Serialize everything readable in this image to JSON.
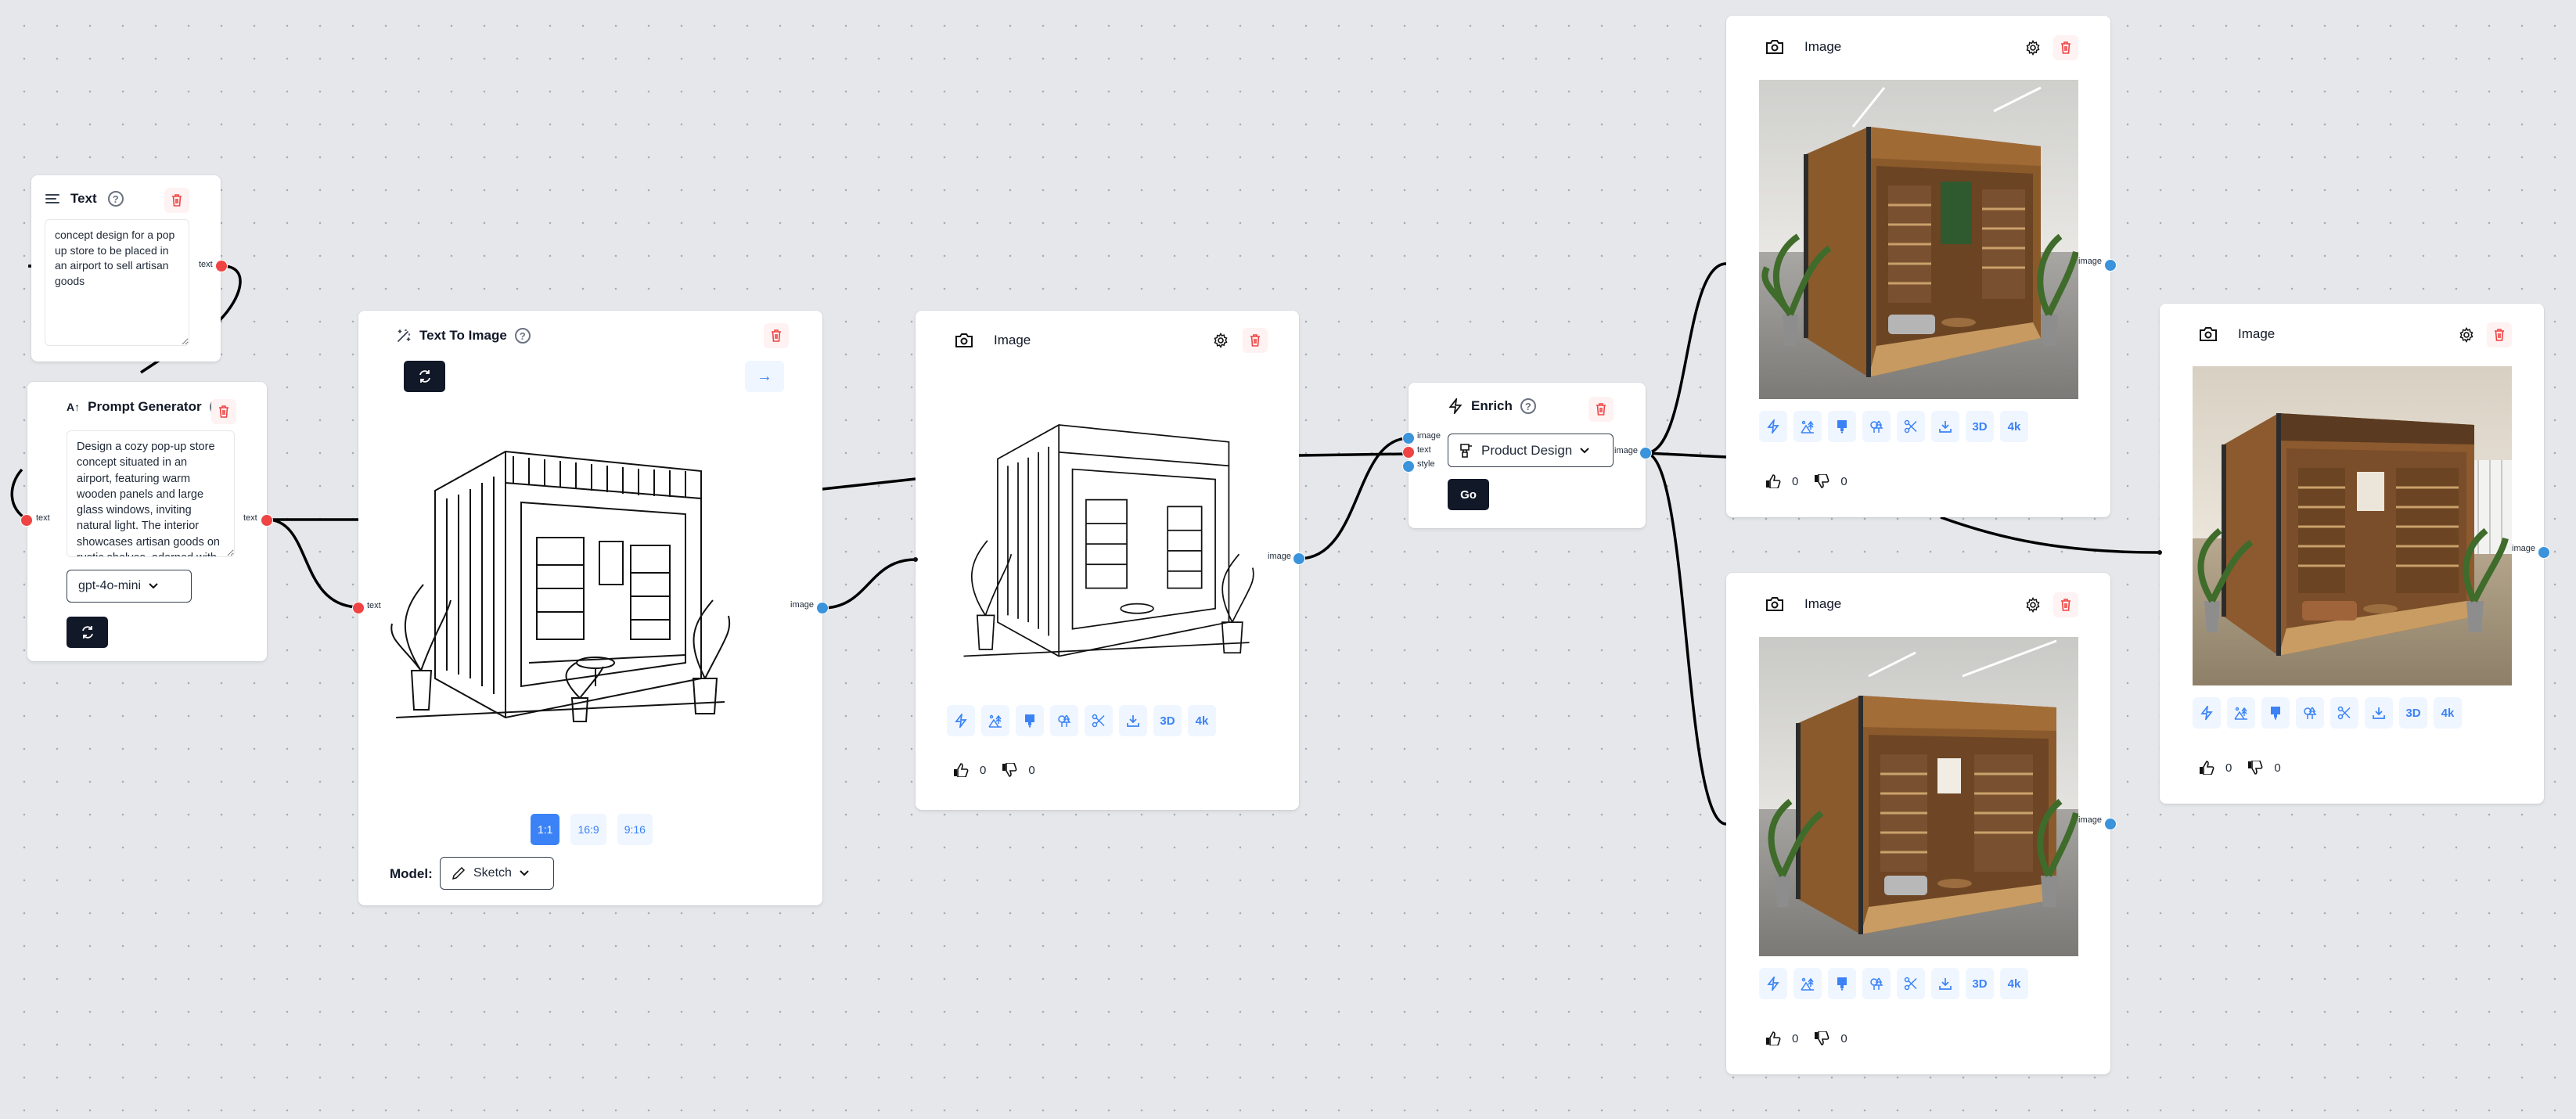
{
  "canvas": {
    "edges": [
      {
        "from": "text-node.text",
        "to": "prompt-generator.text"
      },
      {
        "from": "prompt-generator.text",
        "to": "text-to-image.text"
      },
      {
        "from": "text-to-image.image",
        "to": "image-sketch.image"
      },
      {
        "from": "image-sketch.image",
        "to": "enrich.image"
      },
      {
        "from": "enrich.image",
        "to": "image-top.image"
      },
      {
        "from": "enrich.image",
        "to": "image-bottom.image"
      },
      {
        "from": "enrich.image",
        "to": "image-right.image"
      }
    ]
  },
  "text_node": {
    "title": "Text",
    "help": "?",
    "content": "concept design for a pop up store to be placed in an airport to sell artisan goods",
    "output_port": "text"
  },
  "prompt_generator": {
    "title": "Prompt Generator",
    "help": "?",
    "content": "Design a cozy pop-up store concept situated in an airport, featuring warm wooden panels and large glass windows, inviting natural light. The interior showcases artisan goods on rustic shelves, adorned with potted plants.",
    "model": "gpt-4o-mini",
    "input_port": "text",
    "output_port": "text"
  },
  "text_to_image": {
    "title": "Text To Image",
    "help": "?",
    "input_port": "text",
    "output_port": "image",
    "aspect_ratios": [
      {
        "label": "1:1",
        "active": true
      },
      {
        "label": "16:9",
        "active": false
      },
      {
        "label": "9:16",
        "active": false
      }
    ],
    "model_label": "Model:",
    "model_value": "Sketch",
    "image_alt": "sketch of pop-up store"
  },
  "image_sketch": {
    "title": "Image",
    "input_port": "image",
    "output_port": "image",
    "likes": "0",
    "dislikes": "0"
  },
  "enrich": {
    "title": "Enrich",
    "help": "?",
    "inputs": [
      "image",
      "text",
      "style"
    ],
    "output_port": "image",
    "style": "Product Design",
    "go_label": "Go"
  },
  "image_top": {
    "title": "Image",
    "output_port": "image",
    "likes": "0",
    "dislikes": "0"
  },
  "image_bottom": {
    "title": "Image",
    "output_port": "image",
    "likes": "0",
    "dislikes": "0"
  },
  "image_right": {
    "title": "Image",
    "output_port": "image",
    "likes": "0",
    "dislikes": "0"
  },
  "image_toolbar": {
    "buttons": [
      {
        "icon": "lightning-icon"
      },
      {
        "icon": "landscape-icon"
      },
      {
        "icon": "paintbrush-icon"
      },
      {
        "icon": "trees-icon"
      },
      {
        "icon": "scissors-icon"
      },
      {
        "icon": "download-icon"
      },
      {
        "icon": "3d-label",
        "label": "3D"
      },
      {
        "icon": "4k-label",
        "label": "4k"
      }
    ]
  },
  "colors": {
    "canvas_bg": "#e5e7eb",
    "accent_blue": "#3b82f6",
    "port_blue": "#3b93db",
    "port_red": "#ef4444",
    "dark_button": "#111827",
    "trash_red": "#ef4444"
  }
}
